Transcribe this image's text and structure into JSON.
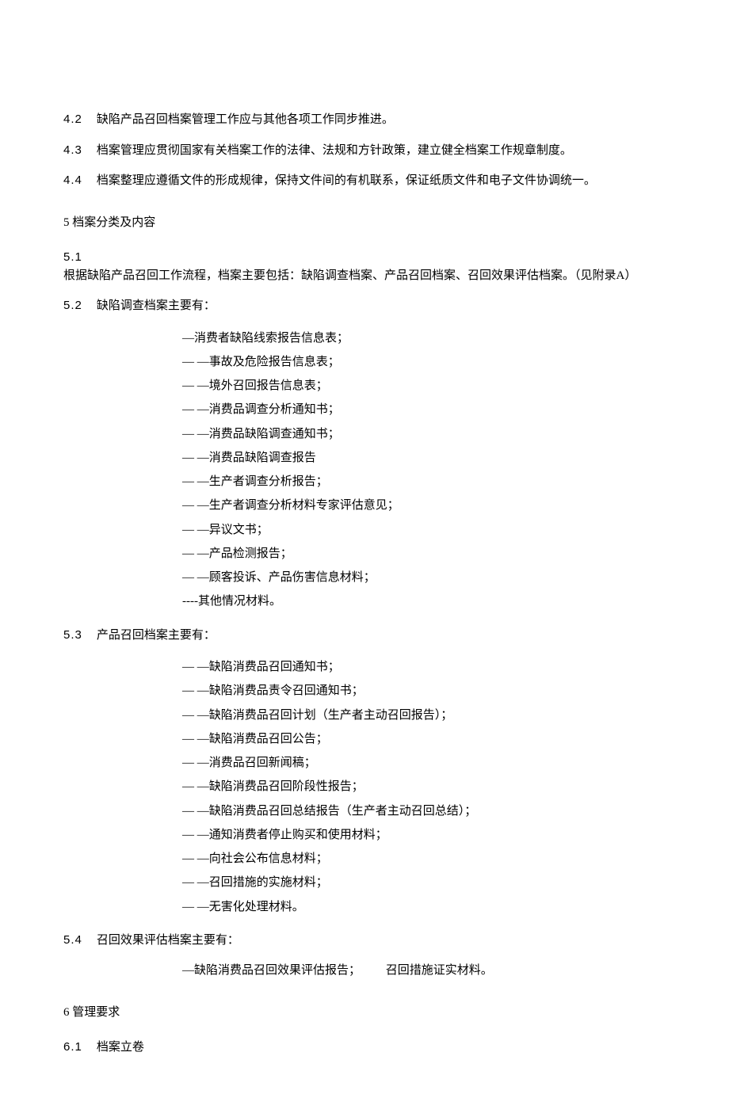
{
  "clauses42": {
    "num": "4.2",
    "text": "缺陷产品召回档案管理工作应与其他各项工作同步推进。"
  },
  "clauses43": {
    "num": "4.3",
    "text": "档案管理应贯彻国家有关档案工作的法律、法规和方针政策，建立健全档案工作规章制度。"
  },
  "clauses44": {
    "num": "4.4",
    "text": "档案整理应遵循文件的形成规律，保持文件间的有机联系，保证纸质文件和电子文件协调统一。"
  },
  "section5": {
    "title": "5 档案分类及内容"
  },
  "clauses51": {
    "num": "5.1",
    "text": "根据缺陷产品召回工作流程，档案主要包括：缺陷调查档案、产品召回档案、召回效果评估档案。（见附录A）"
  },
  "clauses52": {
    "num": "5.2",
    "lead": "缺陷调查档案主要有：",
    "items": [
      "—消费者缺陷线索报告信息表；",
      "—   —事故及危险报告信息表；",
      "—     —境外召回报告信息表；",
      "—   —消费品调查分析通知书；",
      "—   —消费品缺陷调查通知书；",
      "—   —消费品缺陷调查报告",
      "—   —生产者调查分析报告；",
      "—     —生产者调查分析材料专家评估意见；",
      "—   —异议文书；",
      "—   —产品检测报告；",
      "—   —顾客投诉、产品伤害信息材料；",
      "----其他情况材料。"
    ]
  },
  "clauses53": {
    "num": "5.3",
    "lead": "产品召回档案主要有：",
    "items": [
      "—   —缺陷消费品召回通知书；",
      "—   —缺陷消费品责令召回通知书；",
      "—   —缺陷消费品召回计划（生产者主动召回报告）；",
      "—   —缺陷消费品召回公告；",
      "—   —消费品召回新闻稿；",
      "—   —缺陷消费品召回阶段性报告；",
      "—   —缺陷消费品召回总结报告（生产者主动召回总结）；",
      "—   —通知消费者停止购买和使用材料；",
      "—     —向社会公布信息材料；",
      "—   —召回措施的实施材料；",
      "—   —无害化处理材料。"
    ]
  },
  "clauses54": {
    "num": "5.4",
    "lead": "召回效果评估档案主要有：",
    "line1": "—缺陷消费品召回效果评估报告；",
    "line2": "召回措施证实材料。"
  },
  "section6": {
    "title": "6 管理要求"
  },
  "clauses61": {
    "num": "6.1",
    "text": "档案立卷"
  }
}
